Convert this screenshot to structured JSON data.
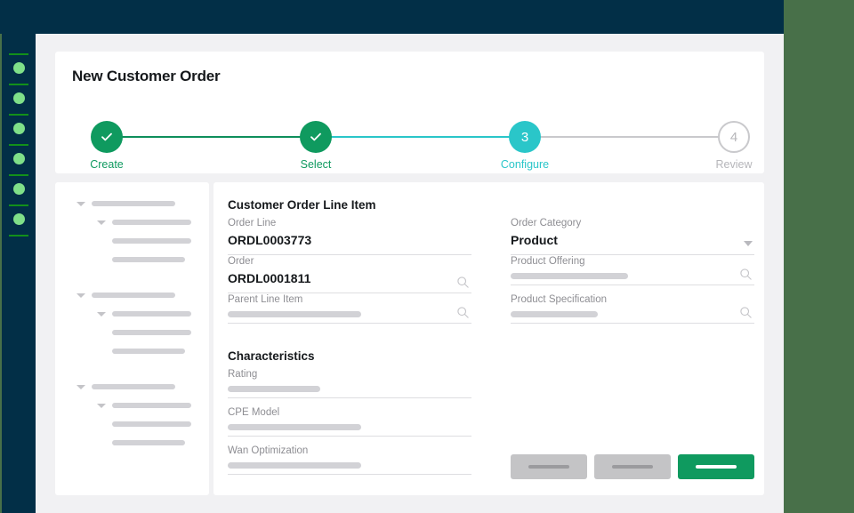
{
  "theme": {
    "navy": "#022f47",
    "page_bg_green": "#487049",
    "app_bg": "#f1f1f3",
    "accent_green": "#0f9a5f",
    "accent_teal": "#2ac6c9",
    "muted_gray": "#b6b6ba",
    "rail_dot_green": "#7fe089",
    "rail_line_green": "#12901a"
  },
  "header": {
    "title": "New Customer Order"
  },
  "stepper": {
    "steps": [
      {
        "number": "1",
        "label": "Create",
        "state": "done",
        "icon": "check-icon"
      },
      {
        "number": "2",
        "label": "Select",
        "state": "done",
        "icon": "check-icon"
      },
      {
        "number": "3",
        "label": "Configure",
        "state": "active",
        "icon": ""
      },
      {
        "number": "4",
        "label": "Review",
        "state": "todo",
        "icon": ""
      }
    ]
  },
  "tree": {
    "groups": [
      {
        "rows": [
          "parent",
          "child-expandable",
          "child",
          "child"
        ]
      },
      {
        "rows": [
          "parent",
          "child-expandable",
          "child",
          "child"
        ]
      },
      {
        "rows": [
          "parent",
          "child-expandable",
          "child",
          "child"
        ]
      }
    ]
  },
  "main": {
    "sections": {
      "order_line_item": "Customer Order Line Item",
      "characteristics": "Characteristics"
    },
    "fields": {
      "order_line": {
        "label": "Order Line",
        "value": "ORDL0003773",
        "icon": ""
      },
      "order": {
        "label": "Order",
        "value": "ORDL0001811",
        "icon": "search-icon"
      },
      "parent_line_item": {
        "label": "Parent Line Item",
        "value": "",
        "icon": "search-icon"
      },
      "order_category": {
        "label": "Order Category",
        "value": "Product",
        "icon": "chevron-down-icon"
      },
      "product_offering": {
        "label": "Product Offering",
        "value": "",
        "icon": "search-icon"
      },
      "product_specification": {
        "label": "Product Specification",
        "value": "",
        "icon": "search-icon"
      },
      "rating": {
        "label": "Rating",
        "value": "",
        "icon": ""
      },
      "cpe_model": {
        "label": "CPE Model",
        "value": "",
        "icon": ""
      },
      "wan_optimization": {
        "label": "Wan Optimization",
        "value": "",
        "icon": ""
      }
    }
  },
  "footer": {
    "buttons": [
      {
        "name": "secondary-button-1",
        "label": "",
        "style": "secondary"
      },
      {
        "name": "secondary-button-2",
        "label": "",
        "style": "secondary"
      },
      {
        "name": "primary-button",
        "label": "",
        "style": "primary"
      }
    ]
  },
  "rail": {
    "items": [
      {
        "name": "rail-item-1"
      },
      {
        "name": "rail-item-2"
      },
      {
        "name": "rail-item-3"
      },
      {
        "name": "rail-item-4"
      },
      {
        "name": "rail-item-5"
      },
      {
        "name": "rail-item-6"
      }
    ]
  }
}
